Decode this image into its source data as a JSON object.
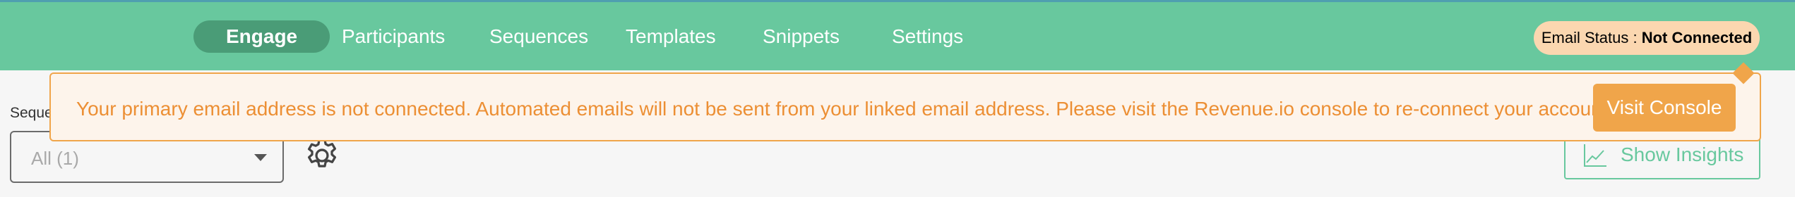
{
  "nav": {
    "tabs": [
      {
        "label": "Engage",
        "active": true
      },
      {
        "label": "Participants",
        "active": false
      },
      {
        "label": "Sequences",
        "active": false
      },
      {
        "label": "Templates",
        "active": false
      },
      {
        "label": "Snippets",
        "active": false
      },
      {
        "label": "Settings",
        "active": false
      }
    ]
  },
  "email_status": {
    "label": "Email Status :",
    "value": "Not Connected"
  },
  "alert": {
    "message": "Your primary email address is not connected. Automated emails will not be sent from your linked email address. Please visit the Revenue.io console to re-connect your account.",
    "button_label": "Visit Console"
  },
  "filters": {
    "sequence_label": "Seque",
    "sequence_value": "All (1)"
  },
  "insights": {
    "button_label": "Show Insights"
  },
  "colors": {
    "brand_green": "#68c89e",
    "active_tab": "#4a9c77",
    "warning_orange": "#f0a54a",
    "status_pill": "#fbd7b0"
  },
  "icons": {
    "settings": "gear-icon",
    "insights": "chart-line-icon",
    "dropdown": "chevron-down-icon"
  }
}
